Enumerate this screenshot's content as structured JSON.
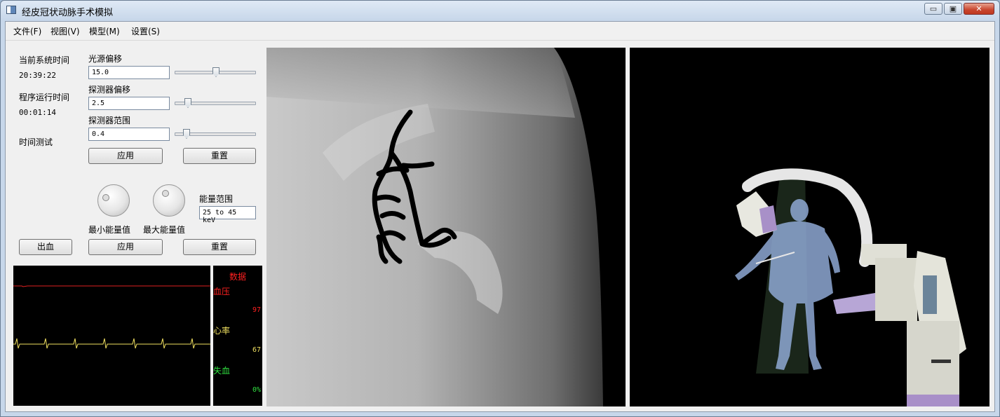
{
  "window": {
    "title": "经皮冠状动脉手术模拟",
    "min": "▭",
    "max": "▣",
    "close": "✕"
  },
  "menu": [
    "文件(F)",
    "视图(V)",
    "模型(M)",
    "设置(S)"
  ],
  "system": {
    "time_label": "当前系统时间",
    "time_value": "20:39:22",
    "run_label": "程序运行时间",
    "run_value": "00:01:14",
    "test_label": "时间测试"
  },
  "controls": {
    "light_offset": {
      "label": "光源偏移",
      "value": "15.0",
      "level": 0.5
    },
    "detector_offset": {
      "label": "探测器偏移",
      "value": "2.5",
      "level": 0.12
    },
    "detector_range": {
      "label": "探测器范围",
      "value": "0.4",
      "level": 0.1
    },
    "apply_label": "应用",
    "reset_label": "重置"
  },
  "energy": {
    "range_label": "能量范围",
    "range_value": "25 to 45 keV",
    "min_label": "最小能量值",
    "max_label": "最大能量值",
    "bleed_label": "出血",
    "apply_label": "应用",
    "reset_label": "重置"
  },
  "vitals": {
    "title": "数据",
    "bp_label": "血压",
    "bp_value": "97",
    "hr_label": "心率",
    "hr_value": "67",
    "blood_label": "失血",
    "blood_value": "0%",
    "colors": {
      "bp": "#ff2020",
      "hr": "#f0e060",
      "blood": "#30e040"
    }
  }
}
